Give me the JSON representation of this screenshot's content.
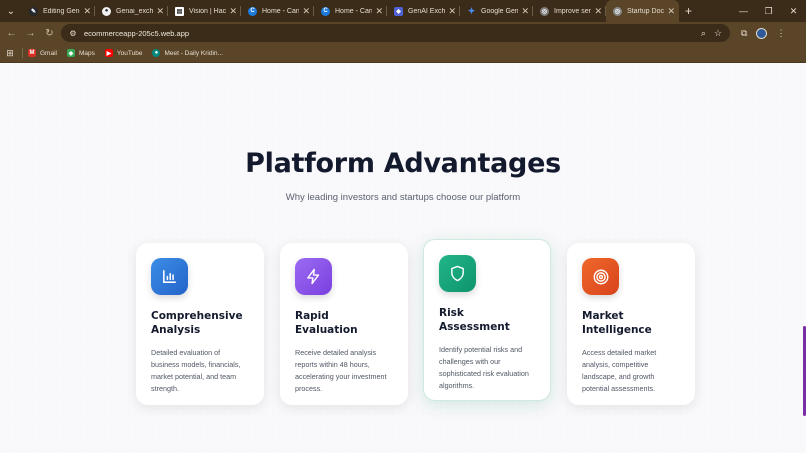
{
  "browser": {
    "tabs": [
      {
        "title": "Editing Genai",
        "icon": "pencil-icon",
        "color": "#24292f"
      },
      {
        "title": "Genai_exchan",
        "icon": "github-icon",
        "color": "#24292f"
      },
      {
        "title": "Vision | Hack",
        "icon": "document-icon",
        "color": "#ffffff"
      },
      {
        "title": "Home - Canv",
        "icon": "canva-icon",
        "color": "#1d7be0"
      },
      {
        "title": "Home - Canv",
        "icon": "canva-icon",
        "color": "#1d7be0"
      },
      {
        "title": "GenAI Exchan",
        "icon": "shield-icon",
        "color": "#4f62d8"
      },
      {
        "title": "Google Gemi",
        "icon": "gemini-icon",
        "color": "#4a8cf0"
      },
      {
        "title": "Improve sent",
        "icon": "globe-icon",
        "color": "#7c7c7c"
      },
      {
        "title": "Startup Docs",
        "icon": "globe-icon",
        "color": "#8a8a8a",
        "active": true
      }
    ],
    "url": "ecommerceapp-205c5.web.app",
    "bookmarks": [
      {
        "label": "Gmail",
        "icon": "gmail-icon",
        "color": "#d93025"
      },
      {
        "label": "Maps",
        "icon": "maps-icon",
        "color": "#34a853"
      },
      {
        "label": "YouTube",
        "icon": "youtube-icon",
        "color": "#ff0000"
      },
      {
        "label": "Meet - Daily Kridin...",
        "icon": "meet-icon",
        "color": "#00897b"
      }
    ]
  },
  "section": {
    "title": "Platform Advantages",
    "subtitle": "Why leading investors and startups choose our platform"
  },
  "cards": [
    {
      "title_line1": "Comprehensive",
      "title_line2": "Analysis",
      "description": "Detailed evaluation of business models, financials, market potential, and team strength.",
      "icon": "bar-chart-icon",
      "gradient_from": "#3b8ee6",
      "gradient_to": "#2563c9"
    },
    {
      "title_line1": "Rapid",
      "title_line2": "Evaluation",
      "description": "Receive detailed analysis reports within 48 hours, accelerating your investment process.",
      "icon": "lightning-icon",
      "gradient_from": "#9b6cf2",
      "gradient_to": "#7a3fe0"
    },
    {
      "title_line1": "Risk",
      "title_line2": "Assessment",
      "description": "Identify potential risks and challenges with our sophisticated risk evaluation algorithms.",
      "icon": "shield-icon",
      "gradient_from": "#22b58a",
      "gradient_to": "#0e946d"
    },
    {
      "title_line1": "Market",
      "title_line2": "Intelligence",
      "description": "Access detailed market analysis, competitive landscape, and growth potential assessments.",
      "icon": "target-icon",
      "gradient_from": "#f0682c",
      "gradient_to": "#d8431a"
    }
  ]
}
